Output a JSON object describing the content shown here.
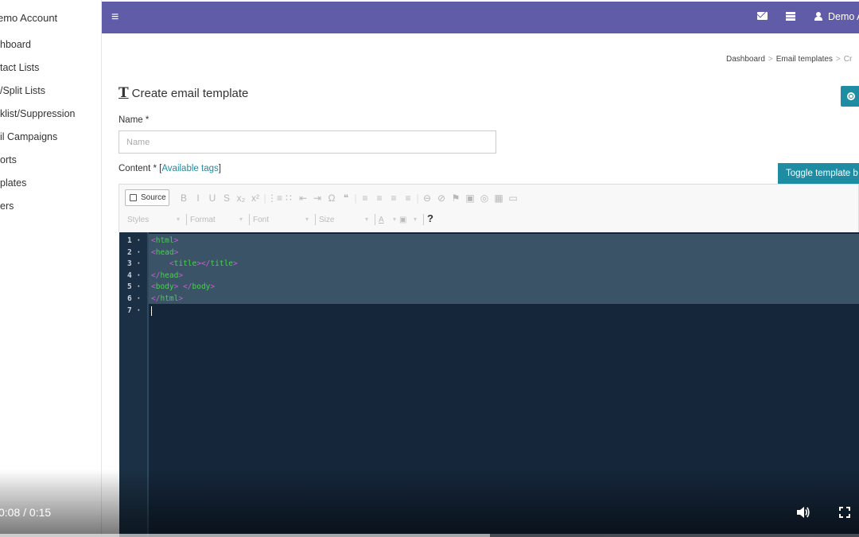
{
  "sidebar": {
    "account": "emo Account",
    "items": [
      {
        "label": "hboard"
      },
      {
        "label": "tact Lists"
      },
      {
        "label": "/Split Lists"
      },
      {
        "label": "klist/Suppression"
      },
      {
        "label": "il Campaigns"
      },
      {
        "label": "orts"
      },
      {
        "label": "plates"
      },
      {
        "label": "ers"
      }
    ]
  },
  "topbar": {
    "menu_icon": "≡",
    "user_name": "Demo A"
  },
  "breadcrumb": {
    "items": [
      "Dashboard",
      "Email templates",
      "Cr"
    ],
    "separator": ">"
  },
  "page": {
    "title": "Create email template",
    "title_icon": "T"
  },
  "form": {
    "name_label": "Name *",
    "name_placeholder": "Name",
    "content_label": "Content * [",
    "available_tags": "Available tags",
    "content_label_end": "]",
    "toggle_button": "Toggle template b"
  },
  "editor": {
    "source_label": "Source",
    "toolbar_row1": [
      "B",
      "I",
      "U",
      "S",
      "x₂",
      "x²",
      "|",
      "⋮≡",
      "∷",
      "⇤",
      "⇥",
      "Ω",
      "❝",
      "|",
      "≡",
      "≡",
      "≡",
      "≡",
      "|",
      "⊖",
      "⊘",
      "⚑",
      "▣",
      "◎",
      "▦",
      "▭"
    ],
    "styles": "Styles",
    "format": "Format",
    "font": "Font",
    "size": "Size",
    "help": "?",
    "code_lines": [
      {
        "num": "1",
        "parts": [
          [
            "br",
            "<"
          ],
          [
            "tg",
            "html"
          ],
          [
            "br",
            ">"
          ]
        ]
      },
      {
        "num": "2",
        "parts": [
          [
            "br",
            "<"
          ],
          [
            "tg",
            "head"
          ],
          [
            "br",
            ">"
          ]
        ]
      },
      {
        "num": "3",
        "parts": [
          [
            "sp",
            "    "
          ],
          [
            "br",
            "<"
          ],
          [
            "tg",
            "title"
          ],
          [
            "br",
            "></"
          ],
          [
            "tg",
            "title"
          ],
          [
            "br",
            ">"
          ]
        ]
      },
      {
        "num": "4",
        "parts": [
          [
            "br",
            "</"
          ],
          [
            "tg",
            "head"
          ],
          [
            "br",
            ">"
          ]
        ]
      },
      {
        "num": "5",
        "parts": [
          [
            "br",
            "<"
          ],
          [
            "tg",
            "body"
          ],
          [
            "br",
            "> </"
          ],
          [
            "tg",
            "body"
          ],
          [
            "br",
            ">"
          ]
        ]
      },
      {
        "num": "6",
        "parts": [
          [
            "br",
            "</"
          ],
          [
            "tg",
            "html"
          ],
          [
            "br",
            ">"
          ]
        ]
      },
      {
        "num": "7",
        "parts": []
      }
    ],
    "colors": {
      "bracket": "#c85fcf",
      "tag": "#48d34a",
      "background": "#15263a"
    }
  },
  "video": {
    "time": "0:08 / 0:15",
    "progress": 0.57
  },
  "colors": {
    "topbar": "#605ca8",
    "accent": "#1e8ca3"
  }
}
